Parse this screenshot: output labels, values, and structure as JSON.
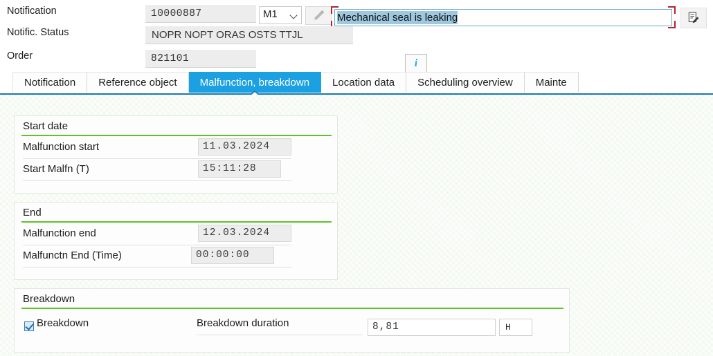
{
  "header": {
    "rows": [
      {
        "label": "Notification",
        "value": "10000887"
      },
      {
        "label": "Notific. Status",
        "value": "NOPR NOPT ORAS OSTS TTJL"
      },
      {
        "label": "Order",
        "value": "821101"
      }
    ],
    "notification_type": "M1",
    "description": "Mechanical seal is leaking",
    "icons": {
      "notification_edit": "pencil-icon",
      "order_edit": "pencil-icon",
      "status_info": "info-icon",
      "long_text": "document-edit-icon",
      "combo_chevron": "chevron-down-icon"
    }
  },
  "tabs": [
    {
      "label": "Notification",
      "active": false
    },
    {
      "label": "Reference object",
      "active": false
    },
    {
      "label": "Malfunction, breakdown",
      "active": true
    },
    {
      "label": "Location data",
      "active": false
    },
    {
      "label": "Scheduling overview",
      "active": false
    },
    {
      "label": "Mainte",
      "active": false
    }
  ],
  "panels": {
    "start_date": {
      "title": "Start date",
      "rows": [
        {
          "label": "Malfunction start",
          "value": "11.03.2024"
        },
        {
          "label": "Start Malfn (T)",
          "value": "15:11:28"
        }
      ]
    },
    "end": {
      "title": "End",
      "rows": [
        {
          "label": "Malfunction end",
          "value": "12.03.2024"
        },
        {
          "label": "Malfunctn End (Time)",
          "value": "00:00:00"
        }
      ]
    },
    "breakdown": {
      "title": "Breakdown",
      "checkbox_label": "Breakdown",
      "checkbox_checked": true,
      "duration_label": "Breakdown duration",
      "duration_value": "8,81",
      "duration_unit": "H"
    }
  },
  "colors": {
    "accent_blue": "#1ba0e2",
    "tab_underline": "#1578b5",
    "panel_rule_green": "#5fc22a",
    "required_red": "#b5232f",
    "selection_blue": "#9ec8e0"
  }
}
